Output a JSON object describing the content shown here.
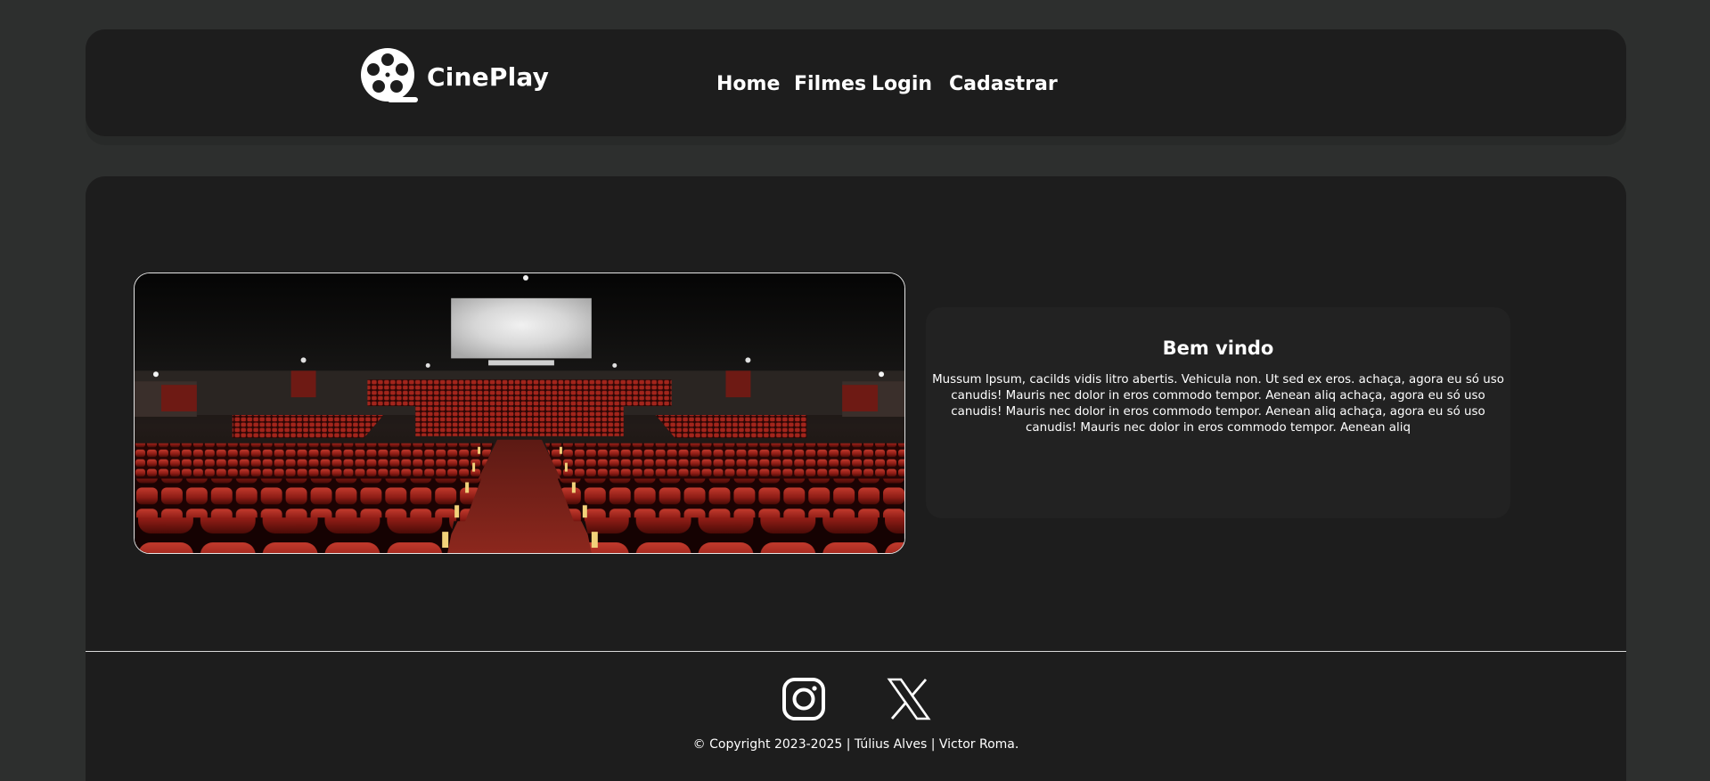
{
  "brand": {
    "name": "CinePlay",
    "logo_icon": "film-reel-icon"
  },
  "nav": {
    "items": [
      {
        "label": "Home"
      },
      {
        "label": "Filmes"
      },
      {
        "label": "Login"
      },
      {
        "label": "Cadastrar"
      }
    ]
  },
  "hero": {
    "image": "cinema-auditorium-image"
  },
  "welcome": {
    "title": "Bem vindo",
    "text": "Mussum Ipsum, cacilds vidis litro abertis. Vehicula non. Ut sed ex eros. achaça, agora eu só uso canudis! Mauris nec dolor in eros commodo tempor. Aenean aliq achaça, agora eu só uso canudis! Mauris nec dolor in eros commodo tempor. Aenean aliq achaça, agora eu só uso canudis! Mauris nec dolor in eros commodo tempor. Aenean aliq"
  },
  "footer": {
    "social": [
      {
        "icon": "instagram-icon"
      },
      {
        "icon": "x-icon"
      }
    ],
    "copyright": "© Copyright 2023-2025 | Túlius Alves | Victor Roma."
  },
  "colors": {
    "page_background": "#2d2f2e",
    "panel_background": "#1d1d1d",
    "card_background": "#222222",
    "text": "#ffffff",
    "seat_red": "#9b1f1b"
  }
}
